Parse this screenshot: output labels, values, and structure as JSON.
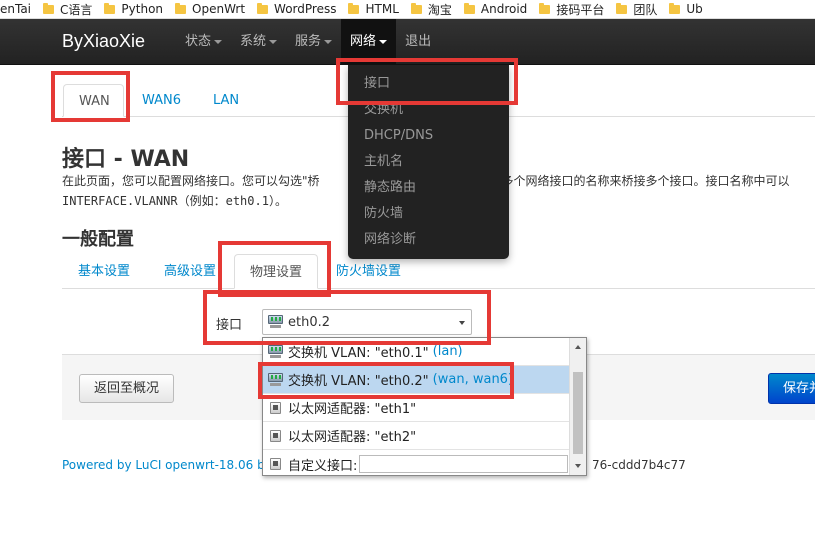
{
  "bookmarks": [
    "enTai",
    "C语言",
    "Python",
    "OpenWrt",
    "WordPress",
    "HTML",
    "淘宝",
    "Android",
    "接码平台",
    "团队",
    "Ub"
  ],
  "brand": "ByXiaoXie",
  "nav": [
    {
      "label": "状态",
      "caret": true
    },
    {
      "label": "系统",
      "caret": true
    },
    {
      "label": "服务",
      "caret": true
    },
    {
      "label": "网络",
      "caret": true
    },
    {
      "label": "退出",
      "caret": false
    }
  ],
  "network_menu": [
    "接口",
    "交换机",
    "DHCP/DNS",
    "主机名",
    "静态路由",
    "防火墙",
    "网络诊断"
  ],
  "top_tabs": [
    "WAN",
    "WAN6",
    "LAN"
  ],
  "page_title": "接口 - WAN",
  "description": {
    "line1": "在此页面，您可以配置网络接口。您可以勾选\"桥",
    "line1_tail": "的多个网络接口的名称来桥接多个接口。接口名称中可以",
    "line2": "INTERFACE.VLANNR（例如：eth0.1）。"
  },
  "section_title": "一般配置",
  "sub_tabs": [
    "基本设置",
    "高级设置",
    "物理设置",
    "防火墙设置"
  ],
  "field": {
    "label": "接口",
    "selected": "eth0.2"
  },
  "dropdown_options": [
    {
      "label": "交换机 VLAN: \"eth0.1\"",
      "tag": "(lan)",
      "icon": "network-switch-icon"
    },
    {
      "label": "交换机 VLAN: \"eth0.2\"",
      "tag": "(wan, wan6)",
      "icon": "network-switch-icon"
    },
    {
      "label": "以太网适配器: \"eth1\"",
      "tag": "",
      "icon": "ethernet-adapter-icon"
    },
    {
      "label": "以太网适配器: \"eth2\"",
      "tag": "",
      "icon": "ethernet-adapter-icon"
    },
    {
      "label": "自定义接口:",
      "tag": "",
      "icon": "ethernet-adapter-icon"
    }
  ],
  "buttons": {
    "back": "返回至概况",
    "save": "保存并"
  },
  "footer": {
    "text": "Powered by LuCI openwrt-18.06 br",
    "tail": "76-cddd7b4c77"
  },
  "colors": {
    "highlight": "#e53935",
    "link": "#0088cc",
    "navbar": "#222222",
    "selected_option": "#bcd7f0"
  }
}
